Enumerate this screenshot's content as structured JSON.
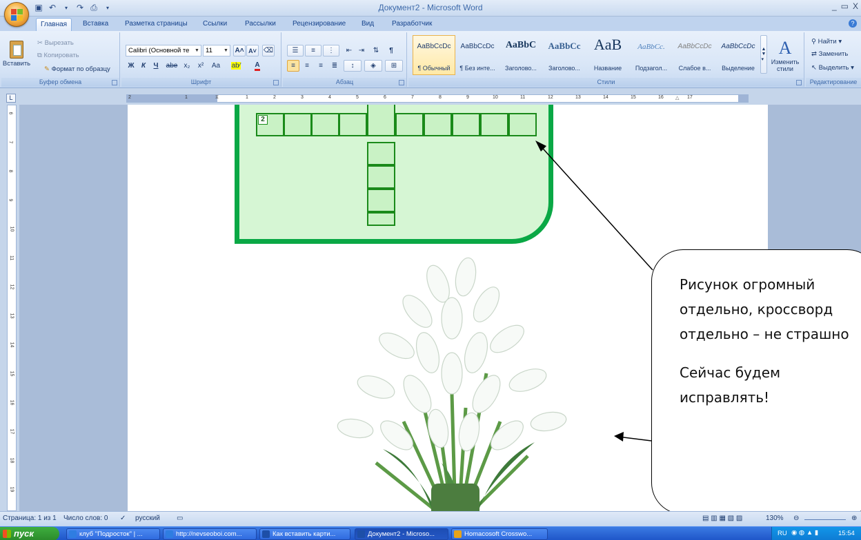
{
  "window": {
    "title": "Документ2 - Microsoft Word",
    "controls": [
      "_",
      "▭",
      "X"
    ]
  },
  "ribbon_tabs": [
    "Главная",
    "Вставка",
    "Разметка страницы",
    "Ссылки",
    "Рассылки",
    "Рецензирование",
    "Вид",
    "Разработчик"
  ],
  "clipboard": {
    "paste": "Вставить",
    "cut": "Вырезать",
    "copy": "Копировать",
    "format_painter": "Формат по образцу",
    "label": "Буфер обмена"
  },
  "font": {
    "name": "Calibri (Основной те",
    "size": "11",
    "label": "Шрифт",
    "bold": "Ж",
    "italic": "К",
    "underline": "Ч",
    "strike": "abe",
    "subscript": "x₂",
    "superscript": "x²",
    "case": "Aa",
    "grow": "A˄",
    "shrink": "A˅",
    "highlight": "ab⁄",
    "color": "A"
  },
  "paragraph": {
    "label": "Абзац"
  },
  "styles": {
    "label": "Стили",
    "items": [
      {
        "sample": "AaBbCcDc",
        "name": "¶ Обычный"
      },
      {
        "sample": "AaBbCcDc",
        "name": "¶ Без инте..."
      },
      {
        "sample": "AaBbC",
        "name": "Заголово..."
      },
      {
        "sample": "AaBbCc",
        "name": "Заголово..."
      },
      {
        "sample": "AaB",
        "name": "Название"
      },
      {
        "sample": "AaBbCc.",
        "name": "Подзагол..."
      },
      {
        "sample": "AaBbCcDc",
        "name": "Слабое в..."
      },
      {
        "sample": "AaBbCcDc",
        "name": "Выделение"
      }
    ],
    "change_styles": "Изменить стили"
  },
  "editing": {
    "label": "Редактирование",
    "find": "Найти",
    "replace": "Заменить",
    "select": "Выделить"
  },
  "ruler": {
    "corner": "L",
    "h_numbers": [
      "2",
      "1",
      "1",
      "2",
      "3",
      "4",
      "5",
      "6",
      "7",
      "8",
      "9",
      "10",
      "11",
      "12",
      "13",
      "14",
      "15",
      "16",
      "17"
    ],
    "v_numbers": [
      "6",
      "7",
      "8",
      "9",
      "10",
      "11",
      "12",
      "13",
      "14",
      "15",
      "16",
      "17",
      "18",
      "19"
    ]
  },
  "crossword": {
    "clue_number": "2"
  },
  "callout": {
    "line1": "Рисунок огромный",
    "line2": "отдельно, кроссворд",
    "line3": "отдельно – не страшно",
    "line4": "Сейчас будем",
    "line5": "исправлять!"
  },
  "status": {
    "page": "Страница: 1 из 1",
    "words": "Число слов: 0",
    "language": "русский",
    "zoom": "130%"
  },
  "taskbar": {
    "start": "пуск",
    "tasks": [
      "клуб \"Подросток\" | ...",
      "http://nevseoboi.com...",
      "Как вставить карти...",
      "Документ2 - Microso...",
      "Homacosoft Crosswo..."
    ],
    "lang": "RU",
    "clock": "15:54"
  },
  "colors": {
    "crossword_border": "#0aa845",
    "crossword_fill": "#d6f6d4",
    "ribbon_bg": "#dae6f7"
  }
}
